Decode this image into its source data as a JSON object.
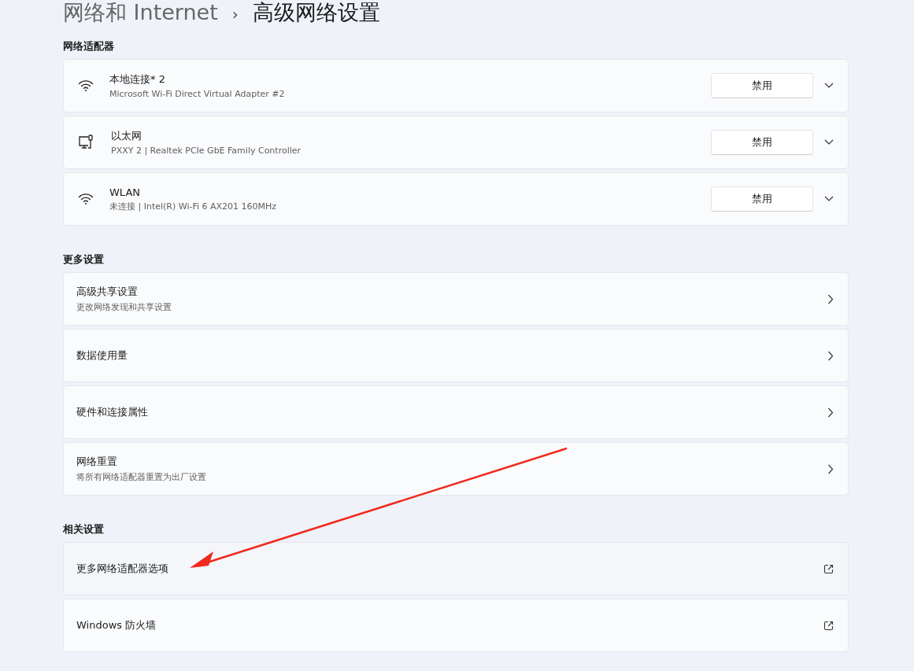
{
  "breadcrumb": {
    "parent": "网络和 Internet",
    "separator": "›",
    "current": "高级网络设置"
  },
  "sections": [
    {
      "title": "网络适配器",
      "kind": "adapters",
      "items": [
        {
          "kind": "wireless",
          "name": "本地连接* 2",
          "description": "Microsoft Wi-Fi Direct Virtual Adapter #2",
          "button": "禁用",
          "expanded": false
        },
        {
          "kind": "wired",
          "name": "以太网",
          "description": "PXXY 2 | Realtek PCIe GbE Family Controller",
          "button": "禁用",
          "expanded": false
        },
        {
          "kind": "wireless",
          "name": "WLAN",
          "description": "未连接 | Intel(R) Wi-Fi 6 AX201 160MHz",
          "button": "禁用",
          "expanded": false
        }
      ]
    },
    {
      "title": "更多设置",
      "kind": "links",
      "items": [
        {
          "kind": "page",
          "name": "高级共享设置",
          "description": "更改网络发现和共享设置"
        },
        {
          "kind": "page",
          "name": "数据使用量"
        },
        {
          "kind": "page",
          "name": "硬件和连接属性"
        },
        {
          "kind": "page",
          "name": "网络重置",
          "description": "将所有网络适配器重置为出厂设置"
        }
      ]
    },
    {
      "title": "相关设置",
      "kind": "links",
      "items": [
        {
          "kind": "external",
          "name": "更多网络适配器选项"
        },
        {
          "kind": "external",
          "name": "Windows 防火墙"
        }
      ]
    }
  ]
}
